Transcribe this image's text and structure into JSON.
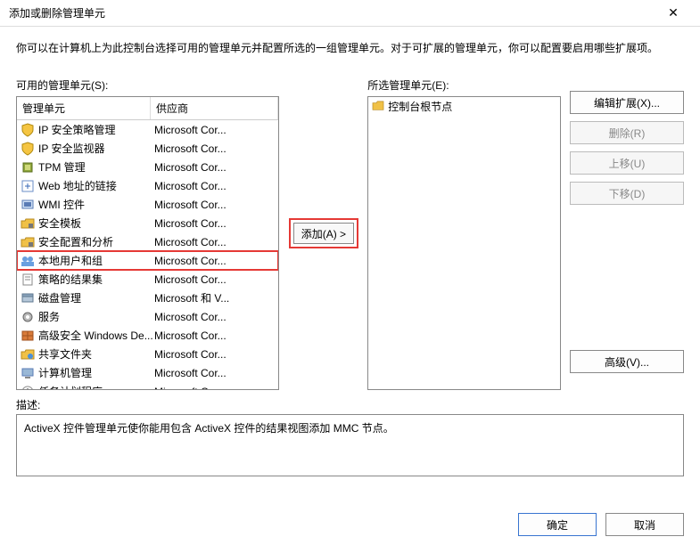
{
  "title": "添加或删除管理单元",
  "instruction": "你可以在计算机上为此控制台选择可用的管理单元并配置所选的一组管理单元。对于可扩展的管理单元，你可以配置要启用哪些扩展项。",
  "labels": {
    "available": "可用的管理单元(S):",
    "selected": "所选管理单元(E):",
    "col_name": "管理单元",
    "col_vendor": "供应商",
    "add": "添加(A) >",
    "edit_ext": "编辑扩展(X)...",
    "remove": "删除(R)",
    "move_up": "上移(U)",
    "move_down": "下移(D)",
    "advanced": "高级(V)...",
    "desc_label": "描述:",
    "ok": "确定",
    "cancel": "取消"
  },
  "available_items": [
    {
      "name": "IP 安全策略管理",
      "vendor": "Microsoft Cor...",
      "icon": "shield-yell"
    },
    {
      "name": "IP 安全监视器",
      "vendor": "Microsoft Cor...",
      "icon": "shield-yell"
    },
    {
      "name": "TPM 管理",
      "vendor": "Microsoft Cor...",
      "icon": "chip"
    },
    {
      "name": "Web 地址的链接",
      "vendor": "Microsoft Cor...",
      "icon": "link"
    },
    {
      "name": "WMI 控件",
      "vendor": "Microsoft Cor...",
      "icon": "wmi"
    },
    {
      "name": "安全模板",
      "vendor": "Microsoft Cor...",
      "icon": "folder-lock"
    },
    {
      "name": "安全配置和分析",
      "vendor": "Microsoft Cor...",
      "icon": "folder-lock"
    },
    {
      "name": "本地用户和组",
      "vendor": "Microsoft Cor...",
      "icon": "users",
      "hl": true
    },
    {
      "name": "策略的结果集",
      "vendor": "Microsoft Cor...",
      "icon": "doc"
    },
    {
      "name": "磁盘管理",
      "vendor": "Microsoft 和 V...",
      "icon": "disk"
    },
    {
      "name": "服务",
      "vendor": "Microsoft Cor...",
      "icon": "gear"
    },
    {
      "name": "高级安全 Windows De...",
      "vendor": "Microsoft Cor...",
      "icon": "firewall"
    },
    {
      "name": "共享文件夹",
      "vendor": "Microsoft Cor...",
      "icon": "share"
    },
    {
      "name": "计算机管理",
      "vendor": "Microsoft Cor...",
      "icon": "computer"
    },
    {
      "name": "任务计划程序",
      "vendor": "Microsoft Cor...",
      "icon": "clock"
    }
  ],
  "selected_root": "控制台根节点",
  "description": "ActiveX 控件管理单元使你能用包含 ActiveX 控件的结果视图添加 MMC 节点。"
}
